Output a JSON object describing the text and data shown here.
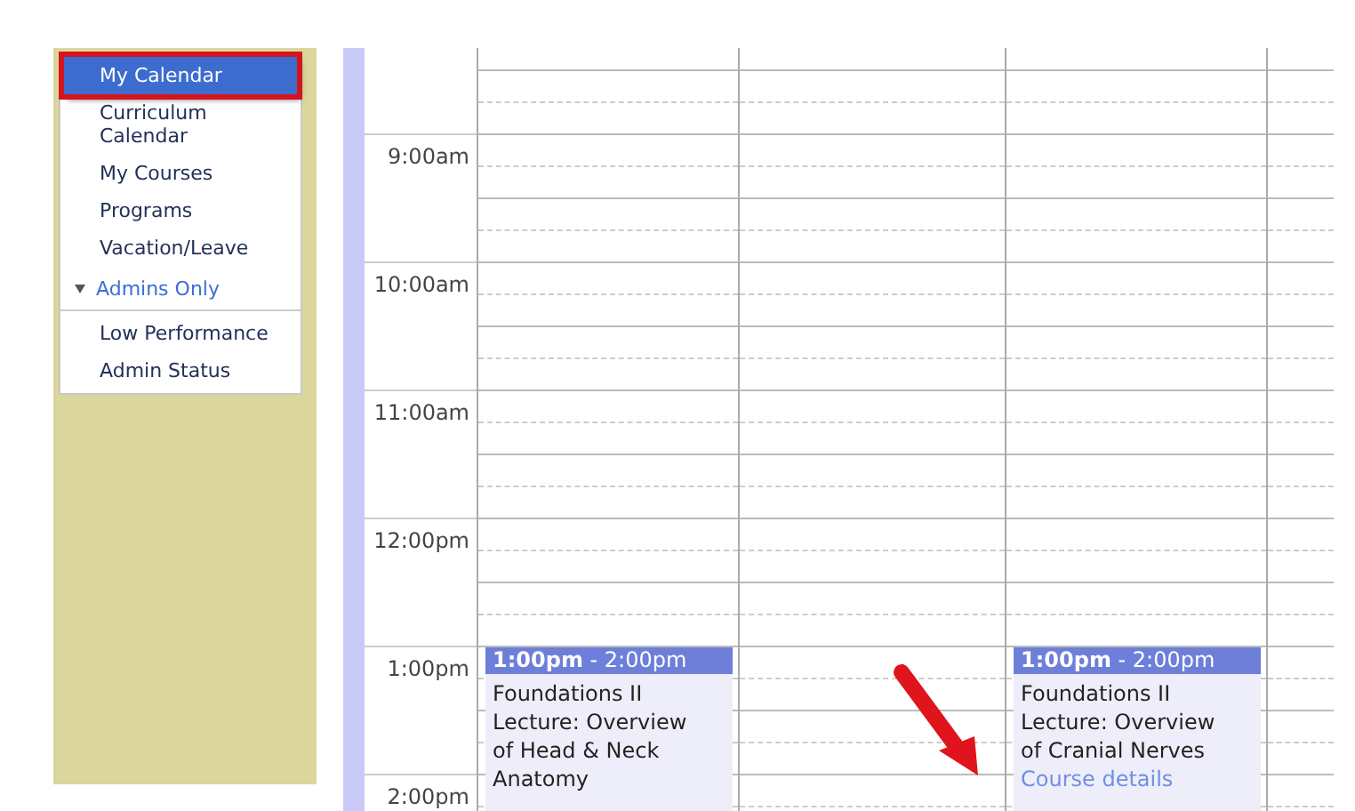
{
  "sidebar": {
    "items": [
      {
        "label": "My Calendar",
        "kind": "link",
        "selected": true
      },
      {
        "label": "Curriculum Calendar",
        "kind": "link",
        "selected": false
      },
      {
        "label": "My Courses",
        "kind": "link",
        "selected": false
      },
      {
        "label": "Programs",
        "kind": "link",
        "selected": false
      },
      {
        "label": "Vacation/Leave",
        "kind": "link",
        "selected": false
      },
      {
        "label": "Admins Only",
        "kind": "section",
        "expanded": true
      },
      {
        "label": "Low Performance",
        "kind": "link",
        "selected": false
      },
      {
        "label": "Admin Status",
        "kind": "link",
        "selected": false
      }
    ]
  },
  "calendar": {
    "times": [
      "9:00am",
      "10:00am",
      "11:00am",
      "12:00pm",
      "1:00pm",
      "2:00pm"
    ],
    "columns": [
      {
        "events": [
          {
            "time": "**1:00pm** - 2:00pm",
            "title": "Foundations II",
            "description": "Lecture: Overview of Head & Neck Anatomy"
          }
        ]
      },
      {},
      {
        "events": [
          {
            "time": "**1:00pm** - 2:00pm",
            "title": "Foundations II",
            "description": "Lecture: Overview of Cranial Nerves",
            "link": "Course details"
          }
        ]
      },
      {}
    ]
  }
}
